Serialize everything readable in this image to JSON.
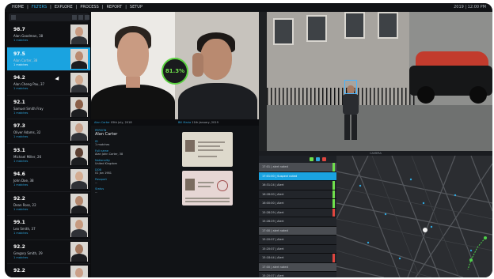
{
  "header": {
    "menu": [
      "HOME",
      "FILTERS",
      "EXPLORE",
      "PROCESS",
      "REPORT",
      "SETUP"
    ],
    "active_index": 1,
    "clock": "2019 | 12:00 PM"
  },
  "results": [
    {
      "score": "98.7",
      "name": "Alan Goodman, 38",
      "meta": "1 matches"
    },
    {
      "score": "97.5",
      "name": "Alan Carter, 38",
      "meta": "1 matches"
    },
    {
      "score": "94.2",
      "name": "Alan Cheng Pau, 37",
      "meta": "1 matches"
    },
    {
      "score": "92.1",
      "name": "Samuel Smith Fray",
      "meta": "1 matches"
    },
    {
      "score": "97.3",
      "name": "Oliver Adams, 32",
      "meta": "1 matches"
    },
    {
      "score": "93.1",
      "name": "Michael Miller, 26",
      "meta": "1 matches"
    },
    {
      "score": "94.6",
      "name": "John Doe, 38",
      "meta": "1 matches"
    },
    {
      "score": "92.2",
      "name": "Dean Ross, 22",
      "meta": "1 matches"
    },
    {
      "score": "99.1",
      "name": "Leo Smith, 37",
      "meta": "1 matches"
    },
    {
      "score": "92.2",
      "name": "Gregory Smith, 29",
      "meta": "1 matches"
    },
    {
      "score": "92.2",
      "name": "",
      "meta": ""
    }
  ],
  "selected_index": 1,
  "match": {
    "badge": "81.3%",
    "left_caption": {
      "label": "Alan Carter",
      "date": "05th July, 2018"
    },
    "right_caption": {
      "label": "Bill Maria",
      "date": "11th January, 2019"
    }
  },
  "details": [
    {
      "label": "PERSON",
      "value": "Alan Carter"
    },
    {
      "label": "ID",
      "value": "",
      "small": "1 matches"
    },
    {
      "label": "Full name",
      "value": "",
      "small": "Alan John Carter, 38"
    },
    {
      "label": "Nationality",
      "value": "",
      "small": "United Kingdom"
    },
    {
      "label": "DOB",
      "value": "",
      "small": "01 Jan 1981"
    },
    {
      "label": "Passport",
      "value": "",
      "small": "..."
    },
    {
      "label": "Status",
      "value": "",
      "small": "..."
    }
  ],
  "panel_title": "CAMERA",
  "alerts": [
    {
      "text": "17:01 | alert noted",
      "color": "#6fe04c",
      "style": "alt"
    },
    {
      "text": "17:01:00 | Suspect noted",
      "color": "",
      "style": "sel"
    },
    {
      "text": "16:31:24 | Alert",
      "color": "#6fe04c",
      "style": ""
    },
    {
      "text": "16:28:00 | Alert",
      "color": "#6fe04c",
      "style": ""
    },
    {
      "text": "16:00:00 | Alert",
      "color": "#6fe04c",
      "style": ""
    },
    {
      "text": "15:28:29 | Alert",
      "color": "#e0463f",
      "style": ""
    },
    {
      "text": "15:28:29 | Alert",
      "color": "",
      "style": ""
    },
    {
      "text": "17:00 | alert noted",
      "color": "",
      "style": "alt"
    },
    {
      "text": "15:20:07 | Alert",
      "color": "",
      "style": ""
    },
    {
      "text": "15:20:07 | Alert",
      "color": "",
      "style": ""
    },
    {
      "text": "15:18:44 | Alert",
      "color": "#e0463f",
      "style": ""
    },
    {
      "text": "17:00 | alert noted",
      "color": "",
      "style": "alt"
    },
    {
      "text": "15:20:07 | Alert",
      "color": "",
      "style": ""
    }
  ],
  "colors": {
    "accent": "#1aa3e0",
    "match": "#5ad23f",
    "alert": "#e0463f"
  }
}
